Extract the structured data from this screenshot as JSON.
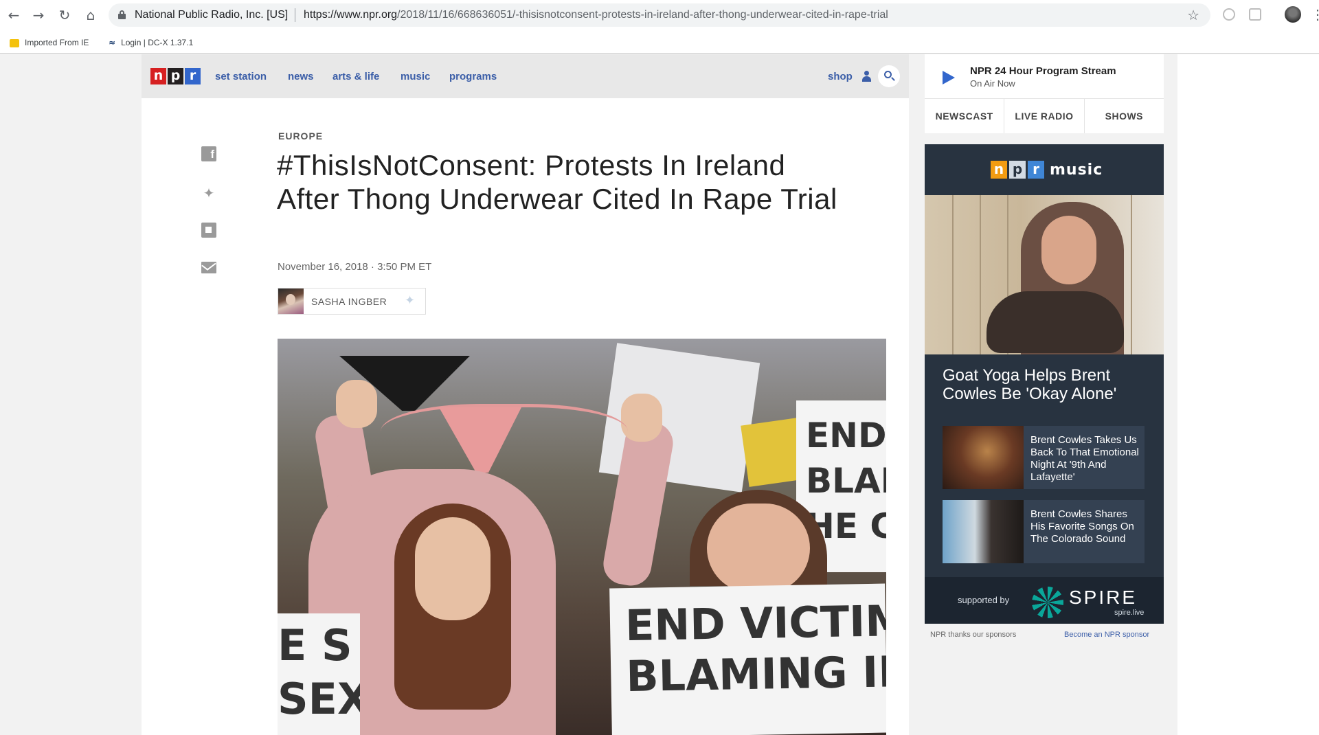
{
  "browser": {
    "cert_label": "National Public Radio, Inc. [US]",
    "url_host": "https://www.npr.org",
    "url_path": "/2018/11/16/668636051/-thisisnotconsent-protests-in-ireland-after-thong-underwear-cited-in-rape-trial",
    "bookmarks": [
      {
        "label": "Imported From IE",
        "icon": "folder-icon"
      },
      {
        "label": "Login | DC-X 1.37.1",
        "icon": "dcx-icon"
      }
    ],
    "icons": {
      "back": "back-arrow-icon",
      "forward": "forward-arrow-icon",
      "reload": "reload-icon",
      "home": "home-icon",
      "star": "star-icon",
      "menu": "kebab-menu-icon"
    }
  },
  "nav": {
    "logo_letters": [
      "n",
      "p",
      "r"
    ],
    "links": [
      "set station",
      "news",
      "arts & life",
      "music",
      "programs"
    ],
    "shop": "shop"
  },
  "article": {
    "section": "EUROPE",
    "headline": "#ThisIsNotConsent: Protests In Ireland After Thong Underwear Cited In Rape Trial",
    "dateline": "November 16, 2018 · 3:50 PM ET",
    "author": "SASHA INGBER",
    "share_icons": [
      "facebook-icon",
      "twitter-icon",
      "flipboard-icon",
      "email-icon"
    ],
    "photo_sign_text": {
      "front": "END VICTIM\nBLAMING IN",
      "right": "END V\nBLAM\nHE C",
      "left": "E S\nSEXI"
    }
  },
  "player": {
    "title": "NPR 24 Hour Program Stream",
    "subtitle": "On Air Now",
    "tabs": [
      "NEWSCAST",
      "LIVE RADIO",
      "SHOWS"
    ]
  },
  "promo": {
    "brand_word": "music",
    "headline": "Goat Yoga Helps Brent Cowles Be 'Okay Alone'",
    "stories": [
      "Brent Cowles Takes Us Back To That Emotional Night At '9th And Lafayette'",
      "Brent Cowles Shares His Favorite Songs On The Colorado Sound"
    ],
    "sponsor_label": "supported by",
    "sponsor_name": "SPIRE",
    "sponsor_sub": "spire.live"
  },
  "sponsor_footer": {
    "note": "NPR thanks our sponsors",
    "link": "Become an NPR sponsor"
  },
  "colors": {
    "npr_red": "#d62021",
    "npr_black": "#231f20",
    "npr_blue": "#3266cc",
    "link_blue": "#3b5ea8",
    "promo_bg": "#283340"
  }
}
